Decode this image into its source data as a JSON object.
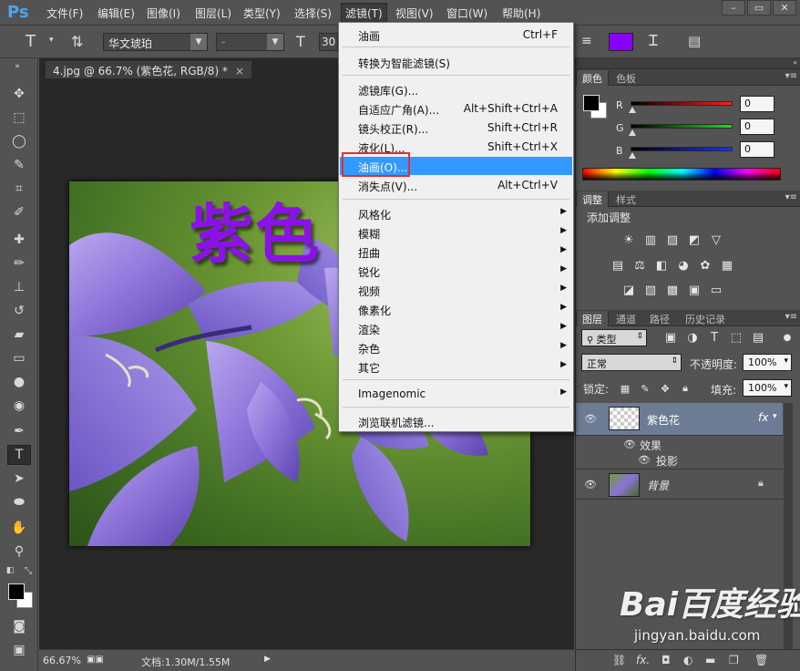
{
  "app": {
    "logo": "Ps"
  },
  "menubar": {
    "items": [
      "文件(F)",
      "编辑(E)",
      "图像(I)",
      "图层(L)",
      "类型(Y)",
      "选择(S)",
      "滤镜(T)",
      "视图(V)",
      "窗口(W)",
      "帮助(H)"
    ],
    "active_item": "滤镜(T)",
    "window_controls": [
      "–",
      "▭",
      "✕"
    ]
  },
  "options_bar": {
    "font_family": "华文琥珀",
    "font_style": "-",
    "font_size": "30",
    "text_color": "#8a00ff"
  },
  "document": {
    "tab_title": "4.jpg @ 66.7% (紫色花, RGB/8) *",
    "tab_close": "×",
    "canvas_text": "紫色"
  },
  "statusbar": {
    "zoom": "66.67%",
    "doc_size": "文档:1.30M/1.55M"
  },
  "filter_menu": {
    "items": [
      {
        "label": "油画",
        "shortcut": "Ctrl+F"
      },
      {
        "label": "转换为智能滤镜(S)"
      },
      {
        "label": "滤镜库(G)..."
      },
      {
        "label": "自适应广角(A)...",
        "shortcut": "Alt+Shift+Ctrl+A"
      },
      {
        "label": "镜头校正(R)...",
        "shortcut": "Shift+Ctrl+R"
      },
      {
        "label": "液化(L)...",
        "shortcut": "Shift+Ctrl+X"
      },
      {
        "label": "油画(O)...",
        "highlighted": true
      },
      {
        "label": "消失点(V)...",
        "shortcut": "Alt+Ctrl+V"
      },
      {
        "label": "风格化",
        "submenu": true
      },
      {
        "label": "模糊",
        "submenu": true
      },
      {
        "label": "扭曲",
        "submenu": true
      },
      {
        "label": "锐化",
        "submenu": true
      },
      {
        "label": "视频",
        "submenu": true
      },
      {
        "label": "像素化",
        "submenu": true
      },
      {
        "label": "渲染",
        "submenu": true
      },
      {
        "label": "杂色",
        "submenu": true
      },
      {
        "label": "其它",
        "submenu": true
      },
      {
        "label": "Imagenomic",
        "submenu": true
      },
      {
        "label": "浏览联机滤镜..."
      }
    ]
  },
  "color_panel": {
    "tabs": [
      "颜色",
      "色板"
    ],
    "channels": [
      {
        "name": "R",
        "value": "0",
        "color": "#ff2020"
      },
      {
        "name": "G",
        "value": "0",
        "color": "#20dd20"
      },
      {
        "name": "B",
        "value": "0",
        "color": "#2030ff"
      }
    ]
  },
  "adjust_panel": {
    "tabs": [
      "调整",
      "样式"
    ],
    "title": "添加调整"
  },
  "layers_panel": {
    "tabs": [
      "图层",
      "通道",
      "路径",
      "历史记录"
    ],
    "filter_kind": "类型",
    "blend_mode": "正常",
    "opacity_label": "不透明度:",
    "opacity_value": "100%",
    "lock_label": "锁定:",
    "fill_label": "填充:",
    "fill_value": "100%",
    "layers": [
      {
        "name": "紫色花",
        "fx": "fx",
        "effects_label": "效果",
        "effect": "投影"
      },
      {
        "name": "背景"
      }
    ]
  },
  "watermark": {
    "main": "Bai百度经验",
    "sub": "jingyan.baidu.com"
  }
}
